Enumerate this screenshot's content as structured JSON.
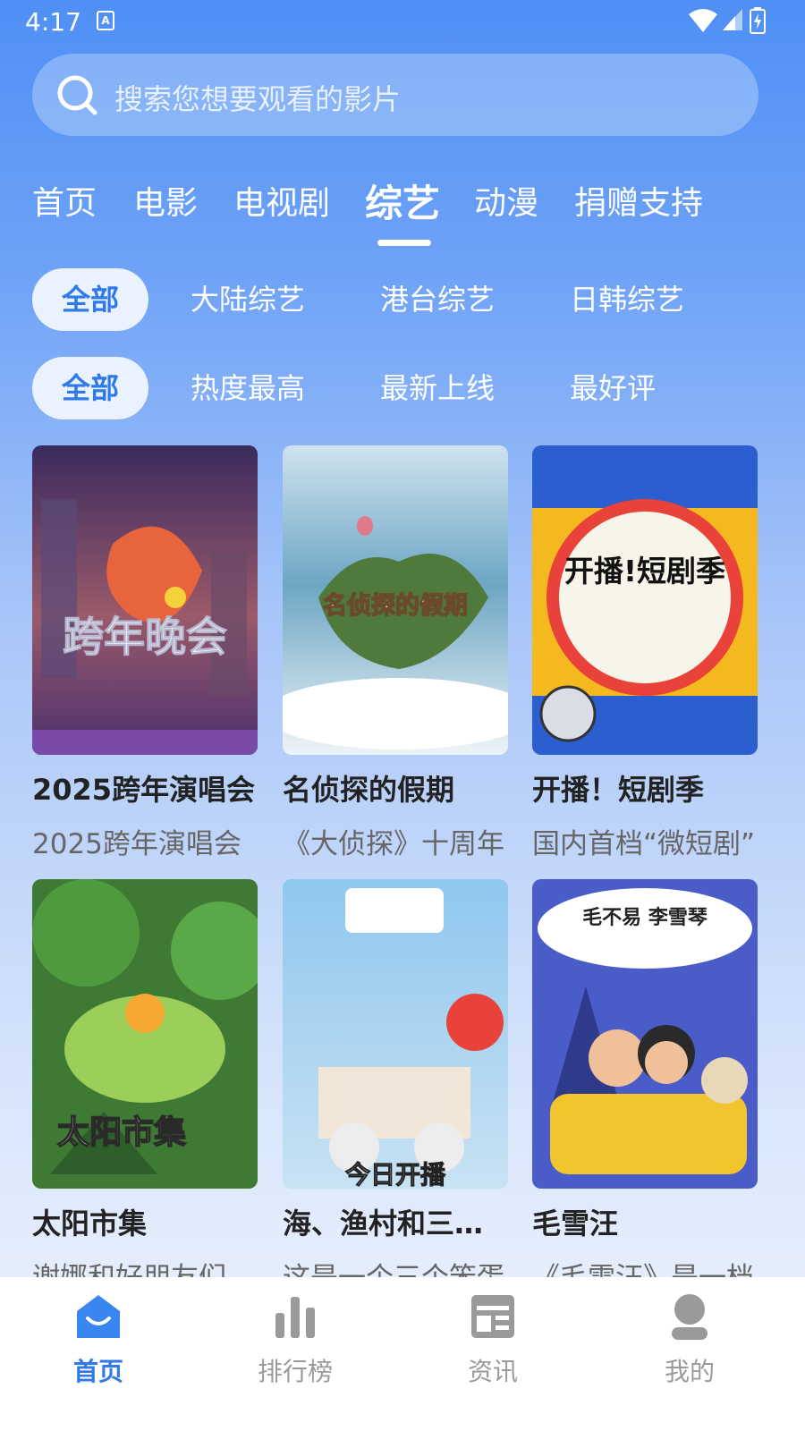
{
  "status_bar": {
    "time": "4:17",
    "notif_letter": "A"
  },
  "search": {
    "placeholder": "搜索您想要观看的影片"
  },
  "tabs": [
    {
      "label": "首页"
    },
    {
      "label": "电影"
    },
    {
      "label": "电视剧"
    },
    {
      "label": "综艺",
      "active": true
    },
    {
      "label": "动漫"
    },
    {
      "label": "捐赠支持"
    }
  ],
  "region_filters": [
    {
      "label": "全部",
      "active": true
    },
    {
      "label": "大陆综艺"
    },
    {
      "label": "港台综艺"
    },
    {
      "label": "日韩综艺"
    }
  ],
  "sort_filters": [
    {
      "label": "全部",
      "active": true
    },
    {
      "label": "热度最高"
    },
    {
      "label": "最新上线"
    },
    {
      "label": "最好评"
    }
  ],
  "shows": [
    {
      "title": "2025跨年演唱会",
      "desc": "2025跨年演唱会",
      "poster_text": "跨年晚会"
    },
    {
      "title": "名侦探的假期",
      "desc": "《大侦探》十周年",
      "poster_text": "名侦探的假期"
    },
    {
      "title": "开播！短剧季",
      "desc": "国内首档“微短剧”",
      "poster_text": "开播!短剧季"
    },
    {
      "title": "太阳市集",
      "desc": "谢娜和好朋友们",
      "poster_text": "太阳市集"
    },
    {
      "title": "海、渔村和三个笨蛋",
      "desc": "这是一个三个笨蛋",
      "poster_text": "今日开播"
    },
    {
      "title": "毛雪汪",
      "desc": "《毛雪汪》是一档",
      "poster_text": "毛不易 李雪琴"
    }
  ],
  "bottom_nav": [
    {
      "label": "首页",
      "icon": "home-icon",
      "active": true
    },
    {
      "label": "排行榜",
      "icon": "chart-icon"
    },
    {
      "label": "资讯",
      "icon": "news-icon"
    },
    {
      "label": "我的",
      "icon": "profile-icon"
    }
  ],
  "colors": {
    "accent": "#2f7ae8",
    "background_top": "#4f8ff5"
  }
}
